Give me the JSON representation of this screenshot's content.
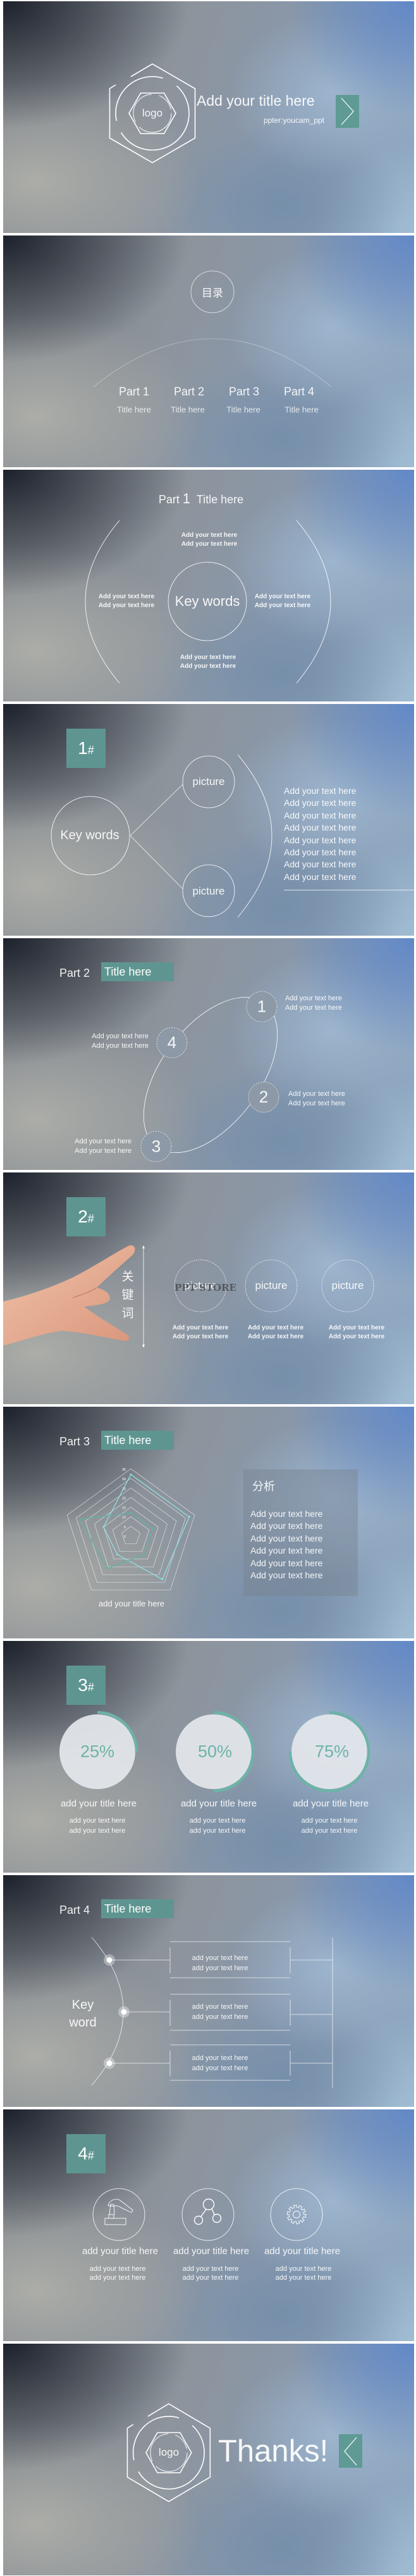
{
  "colors": {
    "accent": "#5f9591",
    "progress": "#6db3a7",
    "progress_track": "#e4e7ec",
    "radar_series_1": "#8fe0df",
    "radar_series_2": "#5fb2a6",
    "line": "#ffffff"
  },
  "cover": {
    "logo": "logo",
    "title": "Add your title here",
    "subtitle": "ppter:youcam_ppt",
    "next_icon": "chevron-right-icon"
  },
  "contents": {
    "heading": "目录",
    "parts": [
      {
        "label": "Part 1",
        "title": "Title here"
      },
      {
        "label": "Part 2",
        "title": "Title here"
      },
      {
        "label": "Part 3",
        "title": "Title here"
      },
      {
        "label": "Part 4",
        "title": "Title here"
      }
    ]
  },
  "part1": {
    "part": "Part",
    "num": "1",
    "title": "Title here",
    "center": "Key words",
    "top": [
      "Add your text here",
      "Add your text here"
    ],
    "left": [
      "Add your text here",
      "Add your text here"
    ],
    "right": [
      "Add your text here",
      "Add your text here"
    ],
    "bottom": [
      "Add your text here",
      "Add your text here"
    ]
  },
  "section1": {
    "badge": "1",
    "hash": "#",
    "center": "Key words",
    "pictures": [
      "picture",
      "picture"
    ],
    "lines": [
      "Add your text here",
      "Add your text here",
      "Add your text here",
      "Add your text here",
      "Add your text here",
      "Add your text here",
      "Add your text here",
      "Add your text here"
    ]
  },
  "part2": {
    "part": "Part 2",
    "title": "Title here",
    "steps": [
      {
        "num": "1",
        "lines": [
          "Add your text here",
          "Add your text here"
        ]
      },
      {
        "num": "2",
        "lines": [
          "Add your text here",
          "Add your text here"
        ]
      },
      {
        "num": "3",
        "lines": [
          "Add your text here",
          "Add your text here"
        ]
      },
      {
        "num": "4",
        "lines": [
          "Add your text here",
          "Add your text here"
        ]
      }
    ]
  },
  "section2": {
    "badge": "2",
    "hash": "#",
    "vertical_label": [
      "关",
      "键",
      "词"
    ],
    "watermark": "PPT STORE",
    "items": [
      {
        "picture": "picture",
        "lines": [
          "Add your text here",
          "Add your text here"
        ]
      },
      {
        "picture": "picture",
        "lines": [
          "Add your text here",
          "Add your text here"
        ]
      },
      {
        "picture": "picture",
        "lines": [
          "Add your text here",
          "Add your text here"
        ]
      }
    ]
  },
  "part3": {
    "part": "Part 3",
    "title": "Title here",
    "analysis_heading": "分析",
    "analysis_lines": [
      "Add your text here",
      "Add your text here",
      "Add your text here",
      "Add your text here",
      "Add your text here",
      "Add your text here"
    ]
  },
  "chart_data": {
    "type": "radar",
    "title": "add your title here",
    "axes_count": 5,
    "rmax": 35,
    "ticks": [
      0,
      5,
      10,
      15,
      20,
      25,
      30,
      35
    ],
    "grid": true,
    "series": [
      {
        "values": [
          32,
          32,
          28,
          12,
          15
        ],
        "color": "#8fe0df"
      },
      {
        "values": [
          12,
          12,
          12,
          21,
          28
        ],
        "color": "#5fb2a6"
      }
    ]
  },
  "section3": {
    "badge": "3",
    "hash": "#",
    "stats": [
      {
        "percent": 25,
        "label": "25%",
        "title": "add your title here",
        "lines": [
          "add your text here",
          "add your text here"
        ]
      },
      {
        "percent": 50,
        "label": "50%",
        "title": "add your title here",
        "lines": [
          "add your text here",
          "add your text here"
        ]
      },
      {
        "percent": 75,
        "label": "75%",
        "title": "add your title here",
        "lines": [
          "add your text here",
          "add your text here"
        ]
      }
    ]
  },
  "part4": {
    "part": "Part 4",
    "title": "Title here",
    "keyword": [
      "Key",
      "word"
    ],
    "items": [
      {
        "lines": [
          "add your text here",
          "add your text here"
        ]
      },
      {
        "lines": [
          "add your text here",
          "add your text here"
        ]
      },
      {
        "lines": [
          "add your text here",
          "add your text here"
        ]
      }
    ]
  },
  "section4": {
    "badge": "4",
    "hash": "#",
    "items": [
      {
        "icon": "hammer-icon",
        "title": "add your title here",
        "lines": [
          "add your text here",
          "add your text here"
        ]
      },
      {
        "icon": "share-nodes-icon",
        "title": "add your title here",
        "lines": [
          "add your text here",
          "add your text here"
        ]
      },
      {
        "icon": "gear-icon",
        "title": "add your title here",
        "lines": [
          "add your text here",
          "add your text here"
        ]
      }
    ]
  },
  "thanks": {
    "logo": "logo",
    "title": "Thanks!",
    "back_icon": "chevron-left-icon"
  }
}
